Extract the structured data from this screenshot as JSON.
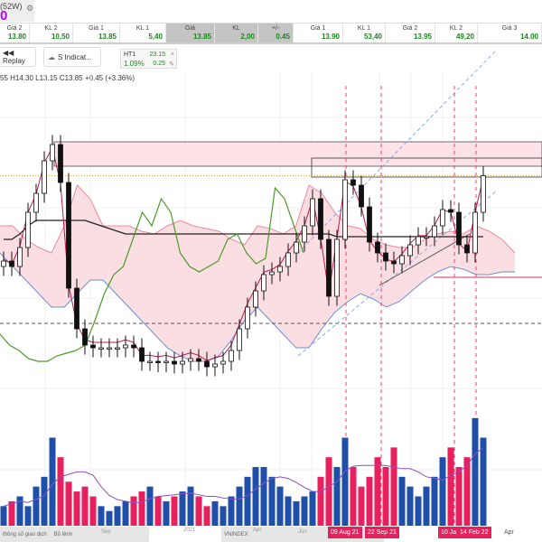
{
  "header": {
    "range_label": "(52W)",
    "value": "0"
  },
  "board": [
    {
      "label": "Giá 2",
      "value": "13.80",
      "grey": false,
      "w": 33
    },
    {
      "label": "KL 2",
      "value": "10,50",
      "grey": false,
      "w": 48
    },
    {
      "label": "Giá 1",
      "value": "13.85",
      "grey": false,
      "w": 52
    },
    {
      "label": "KL 1",
      "value": "5,40",
      "grey": false,
      "w": 51
    },
    {
      "label": "Giá",
      "value": "13.85",
      "grey": true,
      "w": 54
    },
    {
      "label": "KL",
      "value": "2,00",
      "grey": true,
      "w": 48
    },
    {
      "label": "+/-",
      "value": "0.45",
      "grey": true,
      "w": 39
    },
    {
      "label": "Giá 1",
      "value": "13.90",
      "grey": false,
      "w": 55
    },
    {
      "label": "KL 1",
      "value": "53,40",
      "grey": false,
      "w": 47
    },
    {
      "label": "Giá 2",
      "value": "13.95",
      "grey": false,
      "w": 55
    },
    {
      "label": "KL 2",
      "value": "49,20",
      "grey": false,
      "w": 47
    },
    {
      "label": "Giá 3",
      "value": "14.00",
      "grey": false,
      "w": 71
    }
  ],
  "toolbar": {
    "replay": "◀◀ Replay",
    "indicators": "S Indicat...",
    "ht_label": "HT1",
    "ht_pct": "1.09%",
    "ht_val1": "23.15",
    "ht_val2": "0.25"
  },
  "ohlc_text": "55 H14.30 L13.15 C13.85 +0.45 (+3.36%)",
  "footer": {
    "tab1": "thông số giao dịch",
    "tab2": "Bỏ lệnh",
    "tab3": "VNINDEX",
    "x_labels": [
      "Sep",
      "2021",
      "Apr",
      "Jun",
      "Apr"
    ],
    "date_tags": [
      "09 Aug 21",
      "22 Sep 21",
      "10 Ja",
      "14 Feb 22"
    ]
  },
  "chart_data": {
    "type": "candlestick",
    "ylim": [
      5,
      18
    ],
    "closes": [
      10.7,
      10.5,
      11.2,
      12.5,
      13.2,
      14.4,
      15.0,
      13.6,
      9.7,
      8.2,
      7.6,
      7.5,
      7.5,
      7.5,
      7.5,
      7.6,
      7.5,
      7.0,
      7.0,
      6.95,
      7.0,
      6.9,
      7.0,
      7.1,
      7.0,
      6.8,
      6.9,
      7.0,
      7.4,
      8.2,
      9.0,
      9.6,
      10.2,
      10.3,
      10.5,
      11.0,
      11.4,
      12.0,
      13.0,
      11.5,
      9.4,
      11.5,
      13.7,
      13.5,
      12.7,
      11.4,
      11.0,
      10.7,
      10.6,
      10.9,
      11.3,
      11.6,
      11.6,
      12.0,
      12.6,
      12.5,
      11.3,
      11.0,
      12.5,
      13.85
    ],
    "volumes": [
      2,
      2.5,
      3,
      2,
      4,
      5,
      9,
      7,
      4.5,
      3.5,
      4,
      3,
      2,
      1.5,
      2,
      2.5,
      3,
      3.5,
      4,
      3,
      2.5,
      3,
      3.5,
      4,
      3,
      2,
      2.5,
      2,
      3,
      4,
      5,
      6,
      6,
      5,
      4,
      3,
      2.5,
      3,
      3.5,
      5,
      7,
      6,
      9,
      6,
      4,
      5,
      7,
      6,
      8,
      5,
      4,
      3,
      4,
      5,
      7,
      8,
      6,
      7,
      11,
      9
    ],
    "vol_ylim": [
      0,
      12
    ],
    "kijun": [
      11.5,
      11.5,
      11.7,
      12,
      12.2,
      12.2,
      12.2,
      12.2,
      12.2,
      12.2,
      12.2,
      12.1,
      12.0,
      11.9,
      11.8,
      11.7,
      11.7,
      11.7,
      11.7,
      11.7,
      11.7,
      11.7,
      11.7,
      11.7,
      11.7,
      11.7,
      11.7,
      11.7,
      11.7,
      11.7,
      11.7,
      11.7,
      11.7,
      11.7,
      11.7,
      11.7,
      11.7,
      11.7,
      11.7,
      11.7,
      11.7,
      11.6,
      11.6,
      11.6,
      11.6,
      11.6,
      11.6,
      11.6,
      11.6,
      11.6,
      11.6,
      11.6,
      11.6,
      11.6,
      11.6,
      11.6,
      11.6,
      11.6,
      11.6,
      11.6
    ],
    "lagging": [
      8.0,
      7.6,
      7.4,
      7.1,
      7.0,
      7.0,
      7.2,
      7.3,
      7.4,
      7.6,
      8.5,
      9.5,
      10.2,
      10.5,
      11.5,
      12.5,
      12.0,
      13.0,
      12.5,
      11.0,
      10.5,
      10.3,
      10.5,
      10.7,
      11.5,
      11.7,
      11.0,
      10.6,
      10.8,
      13.4,
      13.0,
      12.0,
      11.0
    ],
    "cloud_upper": [
      12,
      12,
      11.5,
      11.2,
      11,
      12,
      13.5,
      13,
      12,
      12,
      12,
      11.8,
      11.7,
      12,
      12.2,
      12,
      11.9,
      11.8,
      11.5,
      11.3,
      12,
      11.9,
      11.7,
      12,
      13.5,
      13.2,
      12.5,
      12,
      11.9,
      11.5,
      11.3,
      11.2,
      11.2,
      11.5,
      11.7,
      11.8,
      11.7,
      12.0,
      11.8,
      11.5,
      11.0
    ],
    "cloud_lower": [
      11,
      10.5,
      10,
      9.5,
      9,
      9,
      9.5,
      10,
      10,
      9.5,
      9,
      8.5,
      8,
      7.5,
      7.2,
      7.0,
      7.0,
      7.2,
      7.8,
      8.5,
      9,
      8.5,
      8,
      7.5,
      7.5,
      8.2,
      8.8,
      9.2,
      9.5,
      9.3,
      9.0,
      9.2,
      9.6,
      10.0,
      10.3,
      10.5,
      10.4,
      10.2,
      10.2,
      10.3,
      10.3
    ],
    "zone": [
      14.2,
      15.1
    ],
    "box": [
      13.8,
      14.5
    ],
    "support_dashed": 8.4,
    "current": 13.85
  }
}
